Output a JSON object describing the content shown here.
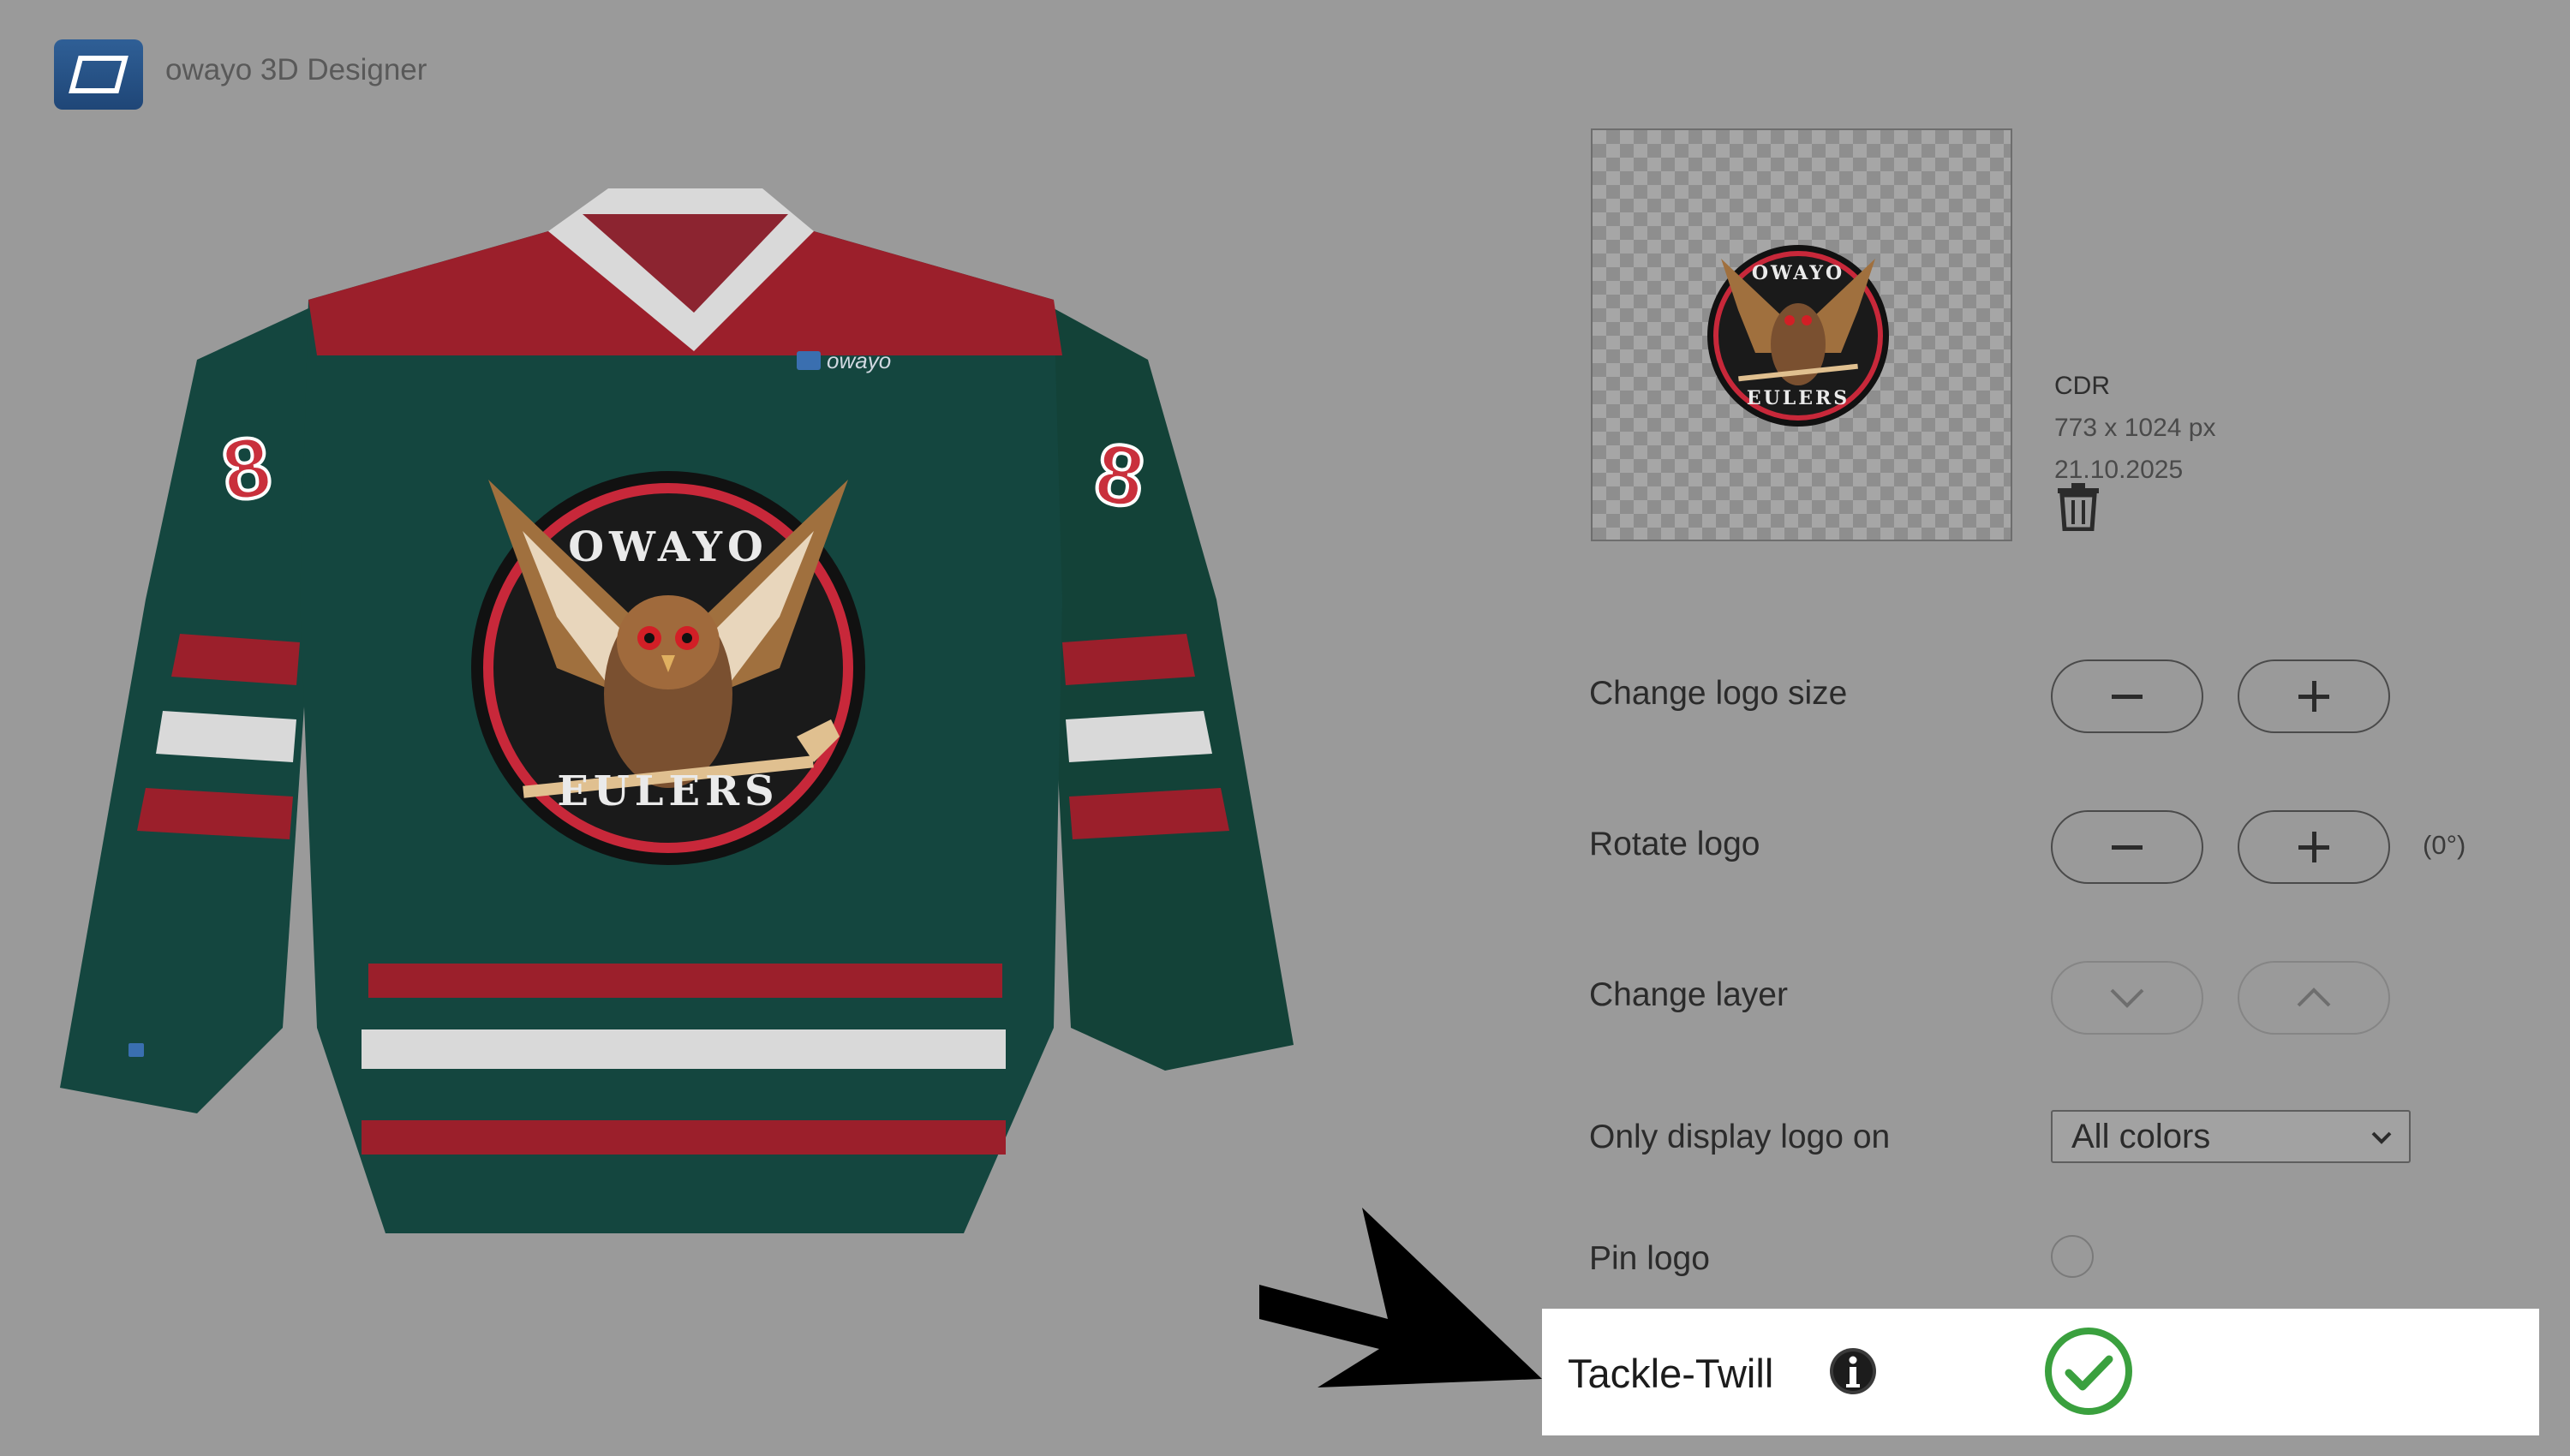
{
  "app": {
    "title": "owayo 3D Designer"
  },
  "jersey": {
    "brand_text": "owayo",
    "crest_top_text": "OWAYO",
    "crest_bottom_text": "EULERS",
    "sleeve_number": "8",
    "colors": {
      "body": "#14463f",
      "red": "#9b1f2b",
      "white": "#d9d9d9"
    }
  },
  "file_info": {
    "format": "CDR",
    "dimensions": "773 x 1024 px",
    "date": "21.10.2025"
  },
  "controls": {
    "size_label": "Change logo size",
    "rotate_label": "Rotate logo",
    "rotation_value": "(0°)",
    "layer_label": "Change layer",
    "display_label": "Only display logo on",
    "display_selected": "All colors",
    "pin_label": "Pin logo"
  },
  "tackle_twill": {
    "label": "Tackle-Twill",
    "enabled": true
  },
  "colors": {
    "background": "#9a9a9a",
    "check_green": "#3aa03e"
  }
}
